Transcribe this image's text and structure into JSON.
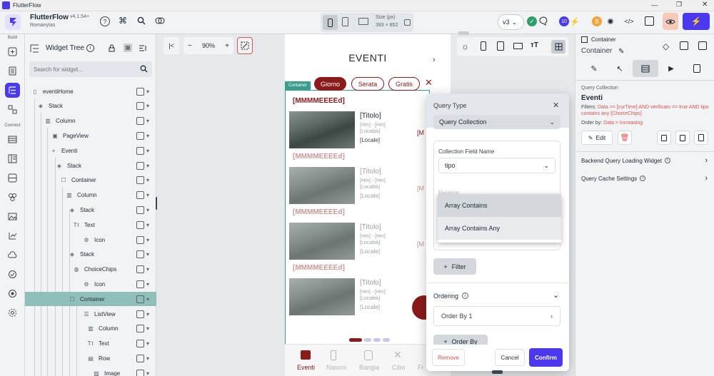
{
  "window": {
    "title": "FlutterFlow",
    "minimize_icon": "minimize-icon",
    "maximize_icon": "maximize-icon",
    "close_icon": "close-icon"
  },
  "topbar": {
    "app_name": "FlutterFlow",
    "version": "v4.1.54+",
    "project": "Romanytas",
    "size_label": "Size (px)",
    "size_value": "393 × 852",
    "version_select": "v3",
    "avatar_badge": "10",
    "user_initial": "B"
  },
  "rail": {
    "build_label": "Build",
    "connect_label": "Connect"
  },
  "widget_tree": {
    "title": "Widget Tree",
    "search_placeholder": "Search for widget...",
    "items": [
      {
        "label": "eventiHome"
      },
      {
        "label": "Stack"
      },
      {
        "label": "Column"
      },
      {
        "label": "PageView"
      },
      {
        "label": "Eventi"
      },
      {
        "label": "Stack"
      },
      {
        "label": "Container"
      },
      {
        "label": "Column"
      },
      {
        "label": "Stack"
      },
      {
        "label": "Text"
      },
      {
        "label": "Icon"
      },
      {
        "label": "Stack"
      },
      {
        "label": "ChoiceChips"
      },
      {
        "label": "Icon"
      },
      {
        "label": "Container"
      },
      {
        "label": "ListView"
      },
      {
        "label": "Column"
      },
      {
        "label": "Text"
      },
      {
        "label": "Row"
      },
      {
        "label": "Image"
      }
    ]
  },
  "canvas_toolbar": {
    "zoom": "90%",
    "minus": "−",
    "plus": "+"
  },
  "phone": {
    "title": "EVENTI",
    "container_tag": "Container",
    "chips": [
      "Giorno",
      "Serata",
      "Gratis"
    ],
    "cards": [
      {
        "date": "[MMMMEEEEd]",
        "title": "[Titolo]",
        "time": "[Hm] - [Hm]",
        "localita": "[Località]",
        "locale": "[Locale]",
        "side": "[M"
      },
      {
        "date": "[MMMMEEEEd]",
        "title": "[Titolo]",
        "time": "[Hm] - [Hm]",
        "localita": "[Località]",
        "locale": "[Locale]",
        "side": "[M"
      },
      {
        "date": "[MMMMEEEEd]",
        "title": "[Titolo]",
        "time": "[Hm] - [Hm]",
        "localita": "[Località]",
        "locale": "[Locale]",
        "side": "[M"
      },
      {
        "date": "[MMMMEEEEd]",
        "title": "[Titolo]",
        "time": "[Hm] - [Hm]",
        "localita": "[Località]",
        "locale": "[Locale]",
        "side": ""
      }
    ],
    "nav": [
      "Eventi",
      "Nasoni",
      "Bangia",
      "Cibo",
      "Fr"
    ]
  },
  "dialog": {
    "query_type_label": "Query Type",
    "query_type_value": "Query Collection",
    "field_name_label": "Collection Field Name",
    "field_name_value": "tipo",
    "relation_label": "Relation",
    "options": [
      "Array Contains",
      "Array Contains Any"
    ],
    "filter_button": "Filter",
    "ordering_label": "Ordering",
    "order_by_value": "Order By 1",
    "order_by_button": "Order By",
    "remove": "Remove",
    "cancel": "Cancel",
    "confirm": "Confirm"
  },
  "props": {
    "widget_type": "Container",
    "widget_name": "Container",
    "section": "Query Collection",
    "collection": "Eventi",
    "filters_label": "Filters:",
    "filters_value": "Data >= [curTime] AND verificato == true AND tipo contains any [ChoiceChips]",
    "order_label": "Order by:",
    "order_value": "Data > Increasing",
    "edit": "Edit",
    "backend_loading": "Backend Query Loading Widget",
    "cache_settings": "Query Cache Settings"
  },
  "colors": {
    "accent": "#4b39ef",
    "brand_red": "#8b1a1a",
    "selection": "#8fbfb8",
    "green": "#2e9e6b"
  }
}
